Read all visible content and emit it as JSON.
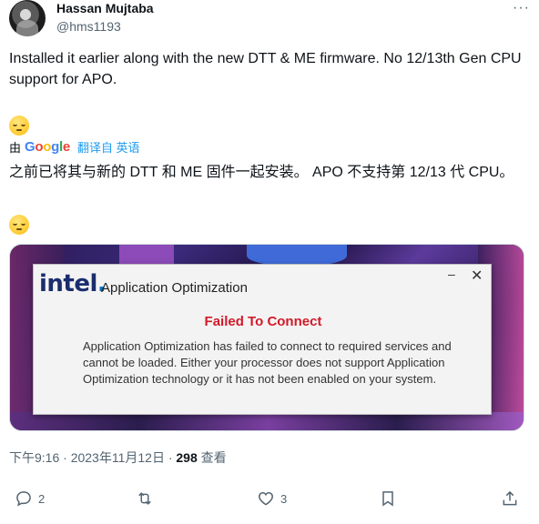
{
  "author": {
    "name": "Hassan Mujtaba",
    "handle": "@hms1193"
  },
  "more_icon": "more-dots-icon",
  "tweet": {
    "text": "Installed it earlier along with the new DTT & ME firmware. No 12/13th Gen CPU support for APO.",
    "emoji": "pensive-face"
  },
  "translation": {
    "prefix": "由",
    "provider": "Google",
    "link": "翻译自 英语",
    "text": "之前已将其与新的 DTT 和 ME 固件一起安装。 APO 不支持第 12/13 代 CPU。"
  },
  "dialog": {
    "brand": "intel",
    "title": "Application Optimization",
    "minimize": "–",
    "close": "✕",
    "error_title": "Failed To Connect",
    "message": "Application Optimization has failed to connect to required services and cannot be loaded. Either your processor does not support Application Optimization technology or it has not been enabled on your system."
  },
  "meta": {
    "timestamp": "下午9:16 · 2023年11月12日 · ",
    "views": "298",
    "views_label": " 查看"
  },
  "actions": {
    "replies": "2",
    "retweets": "",
    "likes": "3"
  }
}
